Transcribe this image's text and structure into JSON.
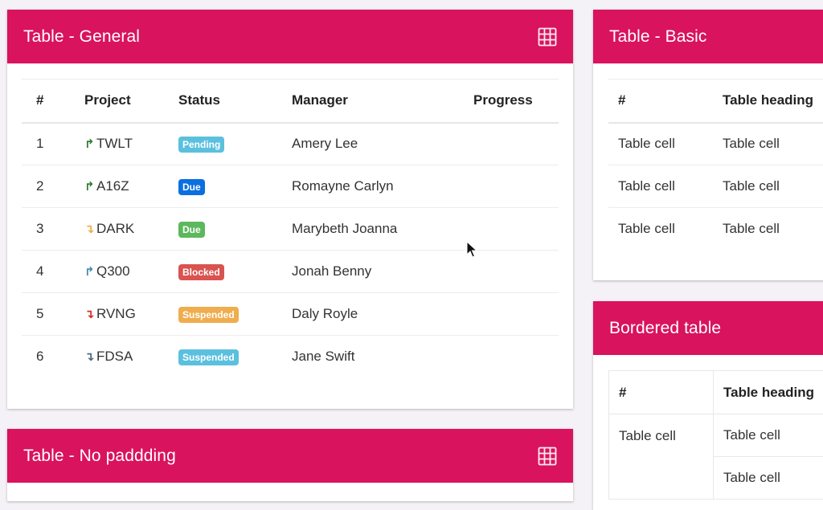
{
  "colors": {
    "header": "#d9135e",
    "page_bg": "#f4f2f6",
    "badge_pending": "#5bc0de",
    "badge_due_blue": "#0a6fe0",
    "badge_due_green": "#5cb85c",
    "badge_blocked": "#d9534f",
    "badge_suspended_orange": "#f0ad4e",
    "badge_suspended_blue": "#5bc0de"
  },
  "general": {
    "title": "Table - General",
    "icon": "grid-icon",
    "columns": [
      "#",
      "Project",
      "Status",
      "Manager",
      "Progress"
    ],
    "rows": [
      {
        "num": "1",
        "project": "TWLT",
        "trend": "up",
        "arrow": "↱",
        "arrow_color": "#2e7d32",
        "status": "Pending",
        "status_color": "#5bc0de",
        "manager": "Amery Lee"
      },
      {
        "num": "2",
        "project": "A16Z",
        "trend": "up",
        "arrow": "↱",
        "arrow_color": "#2e7d32",
        "status": "Due",
        "status_color": "#0a6fe0",
        "manager": "Romayne Carlyn"
      },
      {
        "num": "3",
        "project": "DARK",
        "trend": "down",
        "arrow": "↴",
        "arrow_color": "#f0ad4e",
        "status": "Due",
        "status_color": "#5cb85c",
        "manager": "Marybeth Joanna"
      },
      {
        "num": "4",
        "project": "Q300",
        "trend": "up",
        "arrow": "↱",
        "arrow_color": "#4a8aa8",
        "status": "Blocked",
        "status_color": "#d9534f",
        "manager": "Jonah Benny"
      },
      {
        "num": "5",
        "project": "RVNG",
        "trend": "down",
        "arrow": "↴",
        "arrow_color": "#d32f2f",
        "status": "Suspended",
        "status_color": "#f0ad4e",
        "manager": "Daly Royle"
      },
      {
        "num": "6",
        "project": "FDSA",
        "trend": "down",
        "arrow": "↴",
        "arrow_color": "#4a6a80",
        "status": "Suspended",
        "status_color": "#5bc0de",
        "manager": "Jane Swift"
      }
    ]
  },
  "nopad": {
    "title": "Table - No paddding",
    "icon": "grid-icon"
  },
  "basic": {
    "title": "Table - Basic",
    "columns": [
      "#",
      "Table heading"
    ],
    "rows": [
      [
        "Table cell",
        "Table cell"
      ],
      [
        "Table cell",
        "Table cell"
      ],
      [
        "Table cell",
        "Table cell"
      ]
    ]
  },
  "bordered": {
    "title": "Bordered table",
    "columns": [
      "#",
      "Table heading"
    ],
    "rows": [
      [
        "Table cell",
        "Table cell"
      ],
      [
        "",
        "Table cell"
      ]
    ]
  }
}
